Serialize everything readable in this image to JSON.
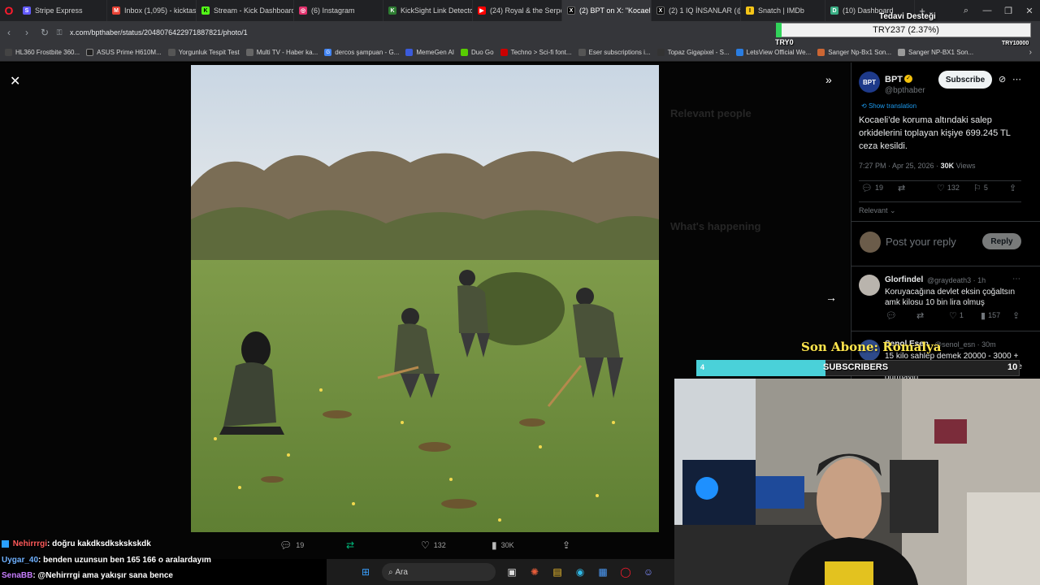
{
  "browser": {
    "tabs": [
      {
        "label": "Stripe Express",
        "color": "#635bff",
        "active": false
      },
      {
        "label": "Inbox (1,095) - kicktaskin",
        "color": "#ea4335",
        "active": false
      },
      {
        "label": "Stream - Kick Dashboard",
        "color": "#53fc18",
        "active": false
      },
      {
        "label": "(6) Instagram",
        "color": "#e1306c",
        "active": false
      },
      {
        "label": "KickSight Link Detector",
        "color": "#2e7d32",
        "active": false
      },
      {
        "label": "(24) Royal & the Serpent",
        "color": "#ff0000",
        "active": false
      },
      {
        "label": "(2) BPT on X: \"Kocaeli'de",
        "color": "#000000",
        "active": true
      },
      {
        "label": "(2) 1 IQ İNSANLAR (@1i",
        "color": "#000000",
        "active": false
      },
      {
        "label": "Snatch | IMDb",
        "color": "#f5c518",
        "active": false
      },
      {
        "label": "(10) Dashboard",
        "color": "#3aaf85",
        "active": false
      }
    ],
    "url": "x.com/bpthaber/status/2048076422971887821/photo/1",
    "bookmarks": [
      {
        "label": "HL360 Frostbite 360...",
        "color": "#444"
      },
      {
        "label": "ASUS Prime H610M...",
        "color": "#222"
      },
      {
        "label": "Yorgunluk Tespit Test",
        "color": "#555"
      },
      {
        "label": "Multi TV - Haber ka...",
        "color": "#666"
      },
      {
        "label": "dercos şampuan - G...",
        "color": "#4285f4"
      },
      {
        "label": "MemeGen AI",
        "color": "#3b5bdb"
      },
      {
        "label": "Duo Go",
        "color": "#58cc02"
      },
      {
        "label": "Techno > Sci-fi font...",
        "color": "#c00"
      },
      {
        "label": "Eser subscriptions i...",
        "color": "#555"
      },
      {
        "label": "Topaz Gigapixel - S...",
        "color": "#333"
      },
      {
        "label": "LetsView Official We...",
        "color": "#2a7de1"
      },
      {
        "label": "Sanger Np-Bx1 Son...",
        "color": "#c63"
      },
      {
        "label": "Sanger NP-BX1 Son...",
        "color": "#999"
      }
    ]
  },
  "ghost": {
    "relevant_people": "Relevant people",
    "whats_happening": "What's happening"
  },
  "tweet": {
    "author_name": "BPT",
    "author_handle": "@bpthaber",
    "subscribe_label": "Subscribe",
    "show_translation": "Show translation",
    "text": "Kocaeli’de koruma altındaki salep orkidelerini toplayan kişiye 699.245 TL ceza kesildi.",
    "timestamp": "7:27 PM · Apr 25, 2026 ·",
    "views_count": "30K",
    "views_label": "Views",
    "replies": "19",
    "likes": "132",
    "bookmarks": "5",
    "relevant_label": "Relevant",
    "reply_placeholder": "Post your reply",
    "reply_button": "Reply",
    "comments": [
      {
        "name": "Glorfindel",
        "meta": "@graydeath3 · 1h",
        "text": "Koruyacağına devlet eksin çoğaltsın amk kilosu 10 bin lira olmuş",
        "replies": "",
        "retweets": "",
        "likes": "1",
        "views": "157"
      },
      {
        "name": "Şenol Esen",
        "meta": "@senol_esn · 30m",
        "text": "15 kilo sahlep demek 20000 - 3000 + orkide fidesini köklemek demek bence durmayin",
        "replies": "",
        "retweets": "",
        "likes": "",
        "views": ""
      }
    ]
  },
  "photo_actions": {
    "replies": "19",
    "likes": "132",
    "views": "30K"
  },
  "stream": {
    "donation_title": "Tedavi Desteği",
    "donation_progress": "TRY237 (2.37%)",
    "donation_progress_fraction": 0.0237,
    "donation_start": "TRY0",
    "donation_goal": "TRY10000",
    "last_sub_label": "Son Abone: Romalya",
    "subs_label": "SUBSCRIBERS",
    "subs_current": "4",
    "subs_goal": "10",
    "chat": [
      {
        "user": "Nehirrrgi",
        "msg": ": doğru kakdksdkskskskdk"
      },
      {
        "user": "Uygar_40",
        "msg": ": benden uzunsun ben 165 166 o aralardayım"
      },
      {
        "user": "SenaBB",
        "msg": ": @Nehirrrgi ama yakışır sana bence"
      }
    ],
    "taskbar_search": "Ara"
  },
  "colors": {
    "twitter_blue": "#1d9bf0",
    "donation_fill": "#31d35a",
    "subs_fill": "#4ad1d9",
    "sub_text": "#ffe64d"
  }
}
